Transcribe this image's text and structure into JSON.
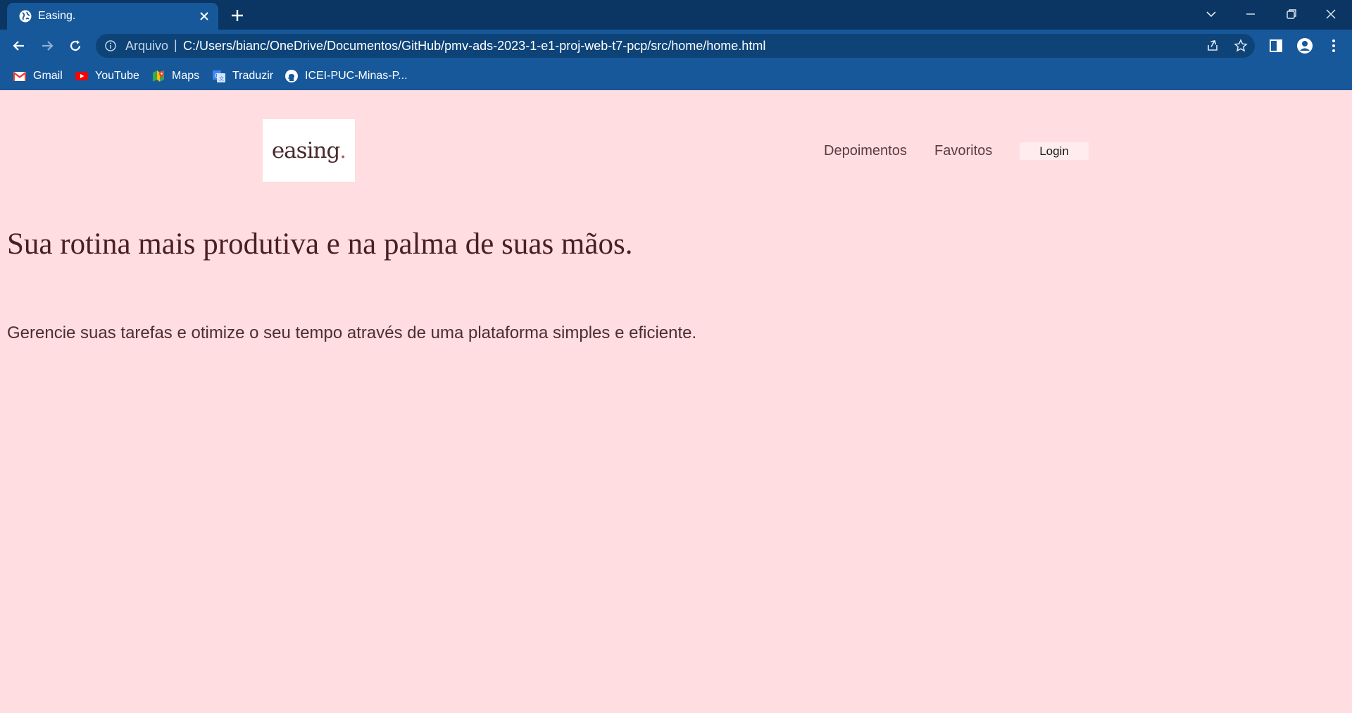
{
  "browser": {
    "tab": {
      "title": "Easing."
    },
    "address_bar": {
      "scheme_label": "Arquivo",
      "separator": "|",
      "url": "C:/Users/bianc/OneDrive/Documentos/GitHub/pmv-ads-2023-1-e1-proj-web-t7-pcp/src/home/home.html"
    },
    "bookmarks": [
      {
        "label": "Gmail",
        "icon": "gmail-icon"
      },
      {
        "label": "YouTube",
        "icon": "youtube-icon"
      },
      {
        "label": "Maps",
        "icon": "maps-icon"
      },
      {
        "label": "Traduzir",
        "icon": "translate-icon"
      },
      {
        "label": "ICEI-PUC-Minas-P...",
        "icon": "github-icon"
      }
    ],
    "colors": {
      "tabstrip": "#0b3563",
      "toolbar": "#17589b",
      "omnibox": "#0e4378"
    }
  },
  "page": {
    "logo": {
      "text": "easing",
      "dot": "."
    },
    "nav": {
      "depoimentos": "Depoimentos",
      "favoritos": "Favoritos",
      "login": "Login"
    },
    "headline": "Sua rotina mais produtiva e na palma de suas mãos.",
    "subtext": "Gerencie suas tarefas e otimize o seu tempo através de uma plataforma simples e eficiente.",
    "colors": {
      "background": "#ffdde0",
      "logo_bg": "#ffffff",
      "login_bg": "#ffecee"
    }
  }
}
